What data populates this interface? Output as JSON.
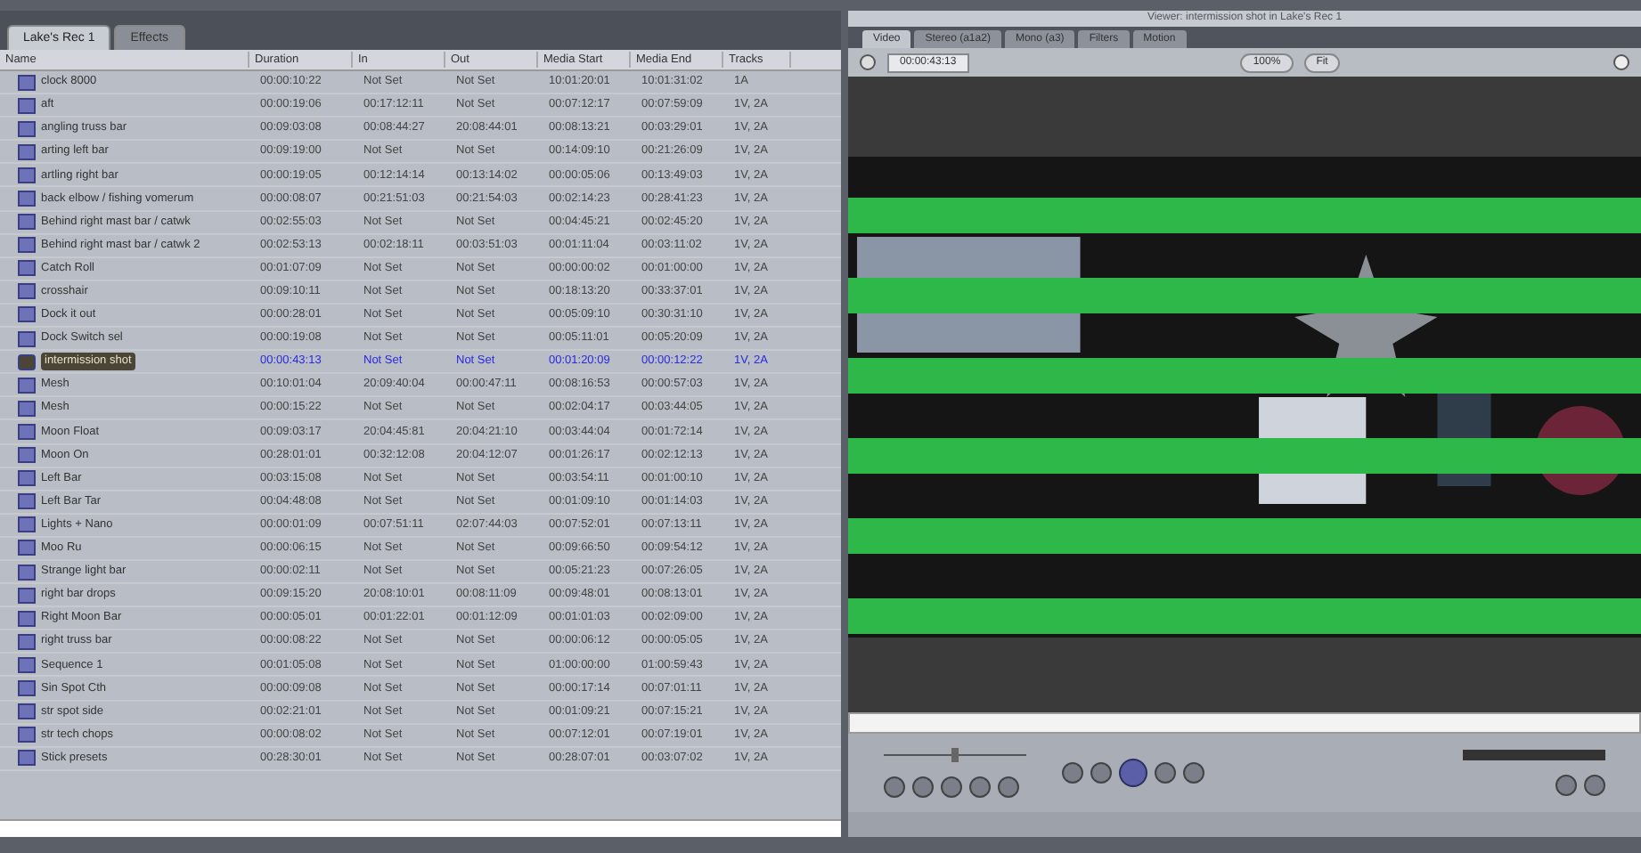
{
  "browser": {
    "tabs": [
      {
        "label": "Lake's Rec 1",
        "selected": true
      },
      {
        "label": "Effects",
        "selected": false
      }
    ],
    "columns": [
      "Name",
      "Duration",
      "In",
      "Out",
      "Media Start",
      "Media End",
      "Tracks"
    ],
    "rows": [
      {
        "name": "clock 8000",
        "duration": "00:00:10:22",
        "in": "Not Set",
        "out": "Not Set",
        "media_start": "10:01:20:01",
        "media_end": "10:01:31:02",
        "tracks": "1A",
        "selected": false
      },
      {
        "name": "aft",
        "duration": "00:00:19:06",
        "in": "00:17:12:11",
        "out": "Not Set",
        "media_start": "00:07:12:17",
        "media_end": "00:07:59:09",
        "tracks": "1V, 2A",
        "selected": false
      },
      {
        "name": "angling truss bar",
        "duration": "00:09:03:08",
        "in": "00:08:44:27",
        "out": "20:08:44:01",
        "media_start": "00:08:13:21",
        "media_end": "00:03:29:01",
        "tracks": "1V, 2A",
        "selected": false
      },
      {
        "name": "arting left bar",
        "duration": "00:09:19:00",
        "in": "Not Set",
        "out": "Not Set",
        "media_start": "00:14:09:10",
        "media_end": "00:21:26:09",
        "tracks": "1V, 2A",
        "selected": false
      },
      {
        "name": "artling right bar",
        "duration": "00:00:19:05",
        "in": "00:12:14:14",
        "out": "00:13:14:02",
        "media_start": "00:00:05:06",
        "media_end": "00:13:49:03",
        "tracks": "1V, 2A",
        "selected": false
      },
      {
        "name": "back elbow / fishing vomerum",
        "duration": "00:00:08:07",
        "in": "00:21:51:03",
        "out": "00:21:54:03",
        "media_start": "00:02:14:23",
        "media_end": "00:28:41:23",
        "tracks": "1V, 2A",
        "selected": false
      },
      {
        "name": "Behind right mast bar / catwk",
        "duration": "00:02:55:03",
        "in": "Not Set",
        "out": "Not Set",
        "media_start": "00:04:45:21",
        "media_end": "00:02:45:20",
        "tracks": "1V, 2A",
        "selected": false
      },
      {
        "name": "Behind right mast bar / catwk 2",
        "duration": "00:02:53:13",
        "in": "00:02:18:11",
        "out": "00:03:51:03",
        "media_start": "00:01:11:04",
        "media_end": "00:03:11:02",
        "tracks": "1V, 2A",
        "selected": false
      },
      {
        "name": "Catch Roll",
        "duration": "00:01:07:09",
        "in": "Not Set",
        "out": "Not Set",
        "media_start": "00:00:00:02",
        "media_end": "00:01:00:00",
        "tracks": "1V, 2A",
        "selected": false
      },
      {
        "name": "crosshair",
        "duration": "00:09:10:11",
        "in": "Not Set",
        "out": "Not Set",
        "media_start": "00:18:13:20",
        "media_end": "00:33:37:01",
        "tracks": "1V, 2A",
        "selected": false
      },
      {
        "name": "Dock it out",
        "duration": "00:00:28:01",
        "in": "Not Set",
        "out": "Not Set",
        "media_start": "00:05:09:10",
        "media_end": "00:30:31:10",
        "tracks": "1V, 2A",
        "selected": false
      },
      {
        "name": "Dock Switch sel",
        "duration": "00:00:19:08",
        "in": "Not Set",
        "out": "Not Set",
        "media_start": "00:05:11:01",
        "media_end": "00:05:20:09",
        "tracks": "1V, 2A",
        "selected": false
      },
      {
        "name": "intermission shot",
        "duration": "00:00:43:13",
        "in": "Not Set",
        "out": "Not Set",
        "media_start": "00:01:20:09",
        "media_end": "00:00:12:22",
        "tracks": "1V, 2A",
        "selected": true
      },
      {
        "name": "Mesh",
        "duration": "00:10:01:04",
        "in": "20:09:40:04",
        "out": "00:00:47:11",
        "media_start": "00:08:16:53",
        "media_end": "00:00:57:03",
        "tracks": "1V, 2A",
        "selected": false
      },
      {
        "name": "Mesh",
        "duration": "00:00:15:22",
        "in": "Not Set",
        "out": "Not Set",
        "media_start": "00:02:04:17",
        "media_end": "00:03:44:05",
        "tracks": "1V, 2A",
        "selected": false
      },
      {
        "name": "Moon Float",
        "duration": "00:09:03:17",
        "in": "20:04:45:81",
        "out": "20:04:21:10",
        "media_start": "00:03:44:04",
        "media_end": "00:01:72:14",
        "tracks": "1V, 2A",
        "selected": false
      },
      {
        "name": "Moon On",
        "duration": "00:28:01:01",
        "in": "00:32:12:08",
        "out": "20:04:12:07",
        "media_start": "00:01:26:17",
        "media_end": "00:02:12:13",
        "tracks": "1V, 2A",
        "selected": false
      },
      {
        "name": "Left Bar",
        "duration": "00:03:15:08",
        "in": "Not Set",
        "out": "Not Set",
        "media_start": "00:03:54:11",
        "media_end": "00:01:00:10",
        "tracks": "1V, 2A",
        "selected": false
      },
      {
        "name": "Left Bar Tar",
        "duration": "00:04:48:08",
        "in": "Not Set",
        "out": "Not Set",
        "media_start": "00:01:09:10",
        "media_end": "00:01:14:03",
        "tracks": "1V, 2A",
        "selected": false
      },
      {
        "name": "Lights + Nano",
        "duration": "00:00:01:09",
        "in": "00:07:51:11",
        "out": "02:07:44:03",
        "media_start": "00:07:52:01",
        "media_end": "00:07:13:11",
        "tracks": "1V, 2A",
        "selected": false
      },
      {
        "name": "Moo Ru",
        "duration": "00:00:06:15",
        "in": "Not Set",
        "out": "Not Set",
        "media_start": "00:09:66:50",
        "media_end": "00:09:54:12",
        "tracks": "1V, 2A",
        "selected": false
      },
      {
        "name": "Strange light bar",
        "duration": "00:00:02:11",
        "in": "Not Set",
        "out": "Not Set",
        "media_start": "00:05:21:23",
        "media_end": "00:07:26:05",
        "tracks": "1V, 2A",
        "selected": false
      },
      {
        "name": "right bar drops",
        "duration": "00:09:15:20",
        "in": "20:08:10:01",
        "out": "00:08:11:09",
        "media_start": "00:09:48:01",
        "media_end": "00:08:13:01",
        "tracks": "1V, 2A",
        "selected": false
      },
      {
        "name": "Right Moon Bar",
        "duration": "00:00:05:01",
        "in": "00:01:22:01",
        "out": "00:01:12:09",
        "media_start": "00:01:01:03",
        "media_end": "00:02:09:00",
        "tracks": "1V, 2A",
        "selected": false
      },
      {
        "name": "right truss bar",
        "duration": "00:00:08:22",
        "in": "Not Set",
        "out": "Not Set",
        "media_start": "00:00:06:12",
        "media_end": "00:00:05:05",
        "tracks": "1V, 2A",
        "selected": false
      },
      {
        "name": "Sequence 1",
        "duration": "00:01:05:08",
        "in": "Not Set",
        "out": "Not Set",
        "media_start": "01:00:00:00",
        "media_end": "01:00:59:43",
        "tracks": "1V, 2A",
        "selected": false
      },
      {
        "name": "Sin Spot Cth",
        "duration": "00:00:09:08",
        "in": "Not Set",
        "out": "Not Set",
        "media_start": "00:00:17:14",
        "media_end": "00:07:01:11",
        "tracks": "1V, 2A",
        "selected": false
      },
      {
        "name": "str spot side",
        "duration": "00:02:21:01",
        "in": "Not Set",
        "out": "Not Set",
        "media_start": "00:01:09:21",
        "media_end": "00:07:15:21",
        "tracks": "1V, 2A",
        "selected": false
      },
      {
        "name": "str tech chops",
        "duration": "00:00:08:02",
        "in": "Not Set",
        "out": "Not Set",
        "media_start": "00:07:12:01",
        "media_end": "00:07:19:01",
        "tracks": "1V, 2A",
        "selected": false
      },
      {
        "name": "Stick presets",
        "duration": "00:28:30:01",
        "in": "Not Set",
        "out": "Not Set",
        "media_start": "00:28:07:01",
        "media_end": "00:03:07:02",
        "tracks": "1V, 2A",
        "selected": false
      }
    ]
  },
  "viewer": {
    "title": "Viewer: intermission shot in Lake's Rec 1",
    "tabs": [
      {
        "label": "Video",
        "selected": true
      },
      {
        "label": "Stereo (a1a2)",
        "selected": false
      },
      {
        "label": "Mono (a3)",
        "selected": false
      },
      {
        "label": "Filters",
        "selected": false
      },
      {
        "label": "Motion",
        "selected": false
      }
    ],
    "timecode": "00:00:43:13",
    "shuttle": {
      "level": 0.5
    },
    "zoom": "100%",
    "view": "Fit"
  }
}
